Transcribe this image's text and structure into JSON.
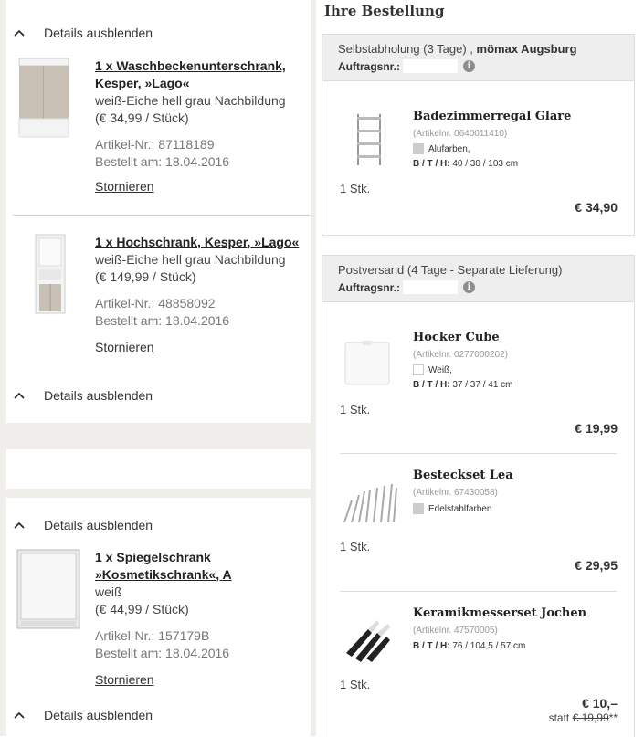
{
  "left": {
    "toggle_label": "Details ausblenden",
    "cancel_label": "Stornieren",
    "products": [
      {
        "title_lines": [
          "1 x Waschbeckenunterschrank,",
          "Kesper, »Lago«"
        ],
        "variant": "weiß-Eiche hell grau Nachbildung",
        "unit_price": "(€ 34,99 / Stück)",
        "article": "Artikel-Nr.:  87118189",
        "ordered": "Bestellt am: 18.04.2016"
      },
      {
        "title_lines": [
          "1 x Hochschrank, Kesper, »Lago«"
        ],
        "variant": "weiß-Eiche hell grau Nachbildung",
        "unit_price": "(€ 149,99 / Stück)",
        "article": "Artikel-Nr.:  48858092",
        "ordered": "Bestellt am: 18.04.2016"
      },
      {
        "title_lines": [
          "1 x Spiegelschrank",
          "»Kosmetikschrank«, A"
        ],
        "variant": "weiß",
        "unit_price": "(€ 44,99 / Stück)",
        "article": "Artikel-Nr.:  157179B",
        "ordered": "Bestellt am: 18.04.2016"
      }
    ]
  },
  "right": {
    "title": "Ihre Bestellung",
    "order_label": "Auftragsnr.:",
    "groups": [
      {
        "delivery": "Selbstabholung (3 Tage) , ",
        "store": "mömax Augsburg",
        "items": [
          {
            "name": "Badezimmerregal Glare",
            "article": "(Artikelnr. 0640011410)",
            "color": "Alufarben,",
            "dims_label": "B / T / H:",
            "dims": " 40 / 30 / 103 cm",
            "qty": "1 Stk.",
            "price": "€ 34,90"
          }
        ]
      },
      {
        "delivery": "Postversand (4 Tage - Separate Lieferung)",
        "store": "",
        "items": [
          {
            "name": "Hocker Cube",
            "article": "(Artikelnr. 0277000202)",
            "color": "Weiß,",
            "dims_label": "B / T / H:",
            "dims": " 37 / 37 / 41 cm",
            "qty": "1 Stk.",
            "price": "€ 19,99"
          },
          {
            "name": "Besteckset Lea",
            "article": "(Artikelnr. 67430058)",
            "color": "Edelstahlfarben",
            "qty": "1 Stk.",
            "price": "€ 29,95"
          },
          {
            "name": "Keramikmesserset Jochen",
            "article": "(Artikelnr. 47570005)",
            "dims_label": "B / T / H:",
            "dims": " 76 / 104,5 / 57 cm",
            "qty": "1 Stk.",
            "price": "€ 10,–",
            "old_prefix": "statt ",
            "old_price": "€ 19,99",
            "old_suffix": "**"
          }
        ]
      }
    ]
  }
}
